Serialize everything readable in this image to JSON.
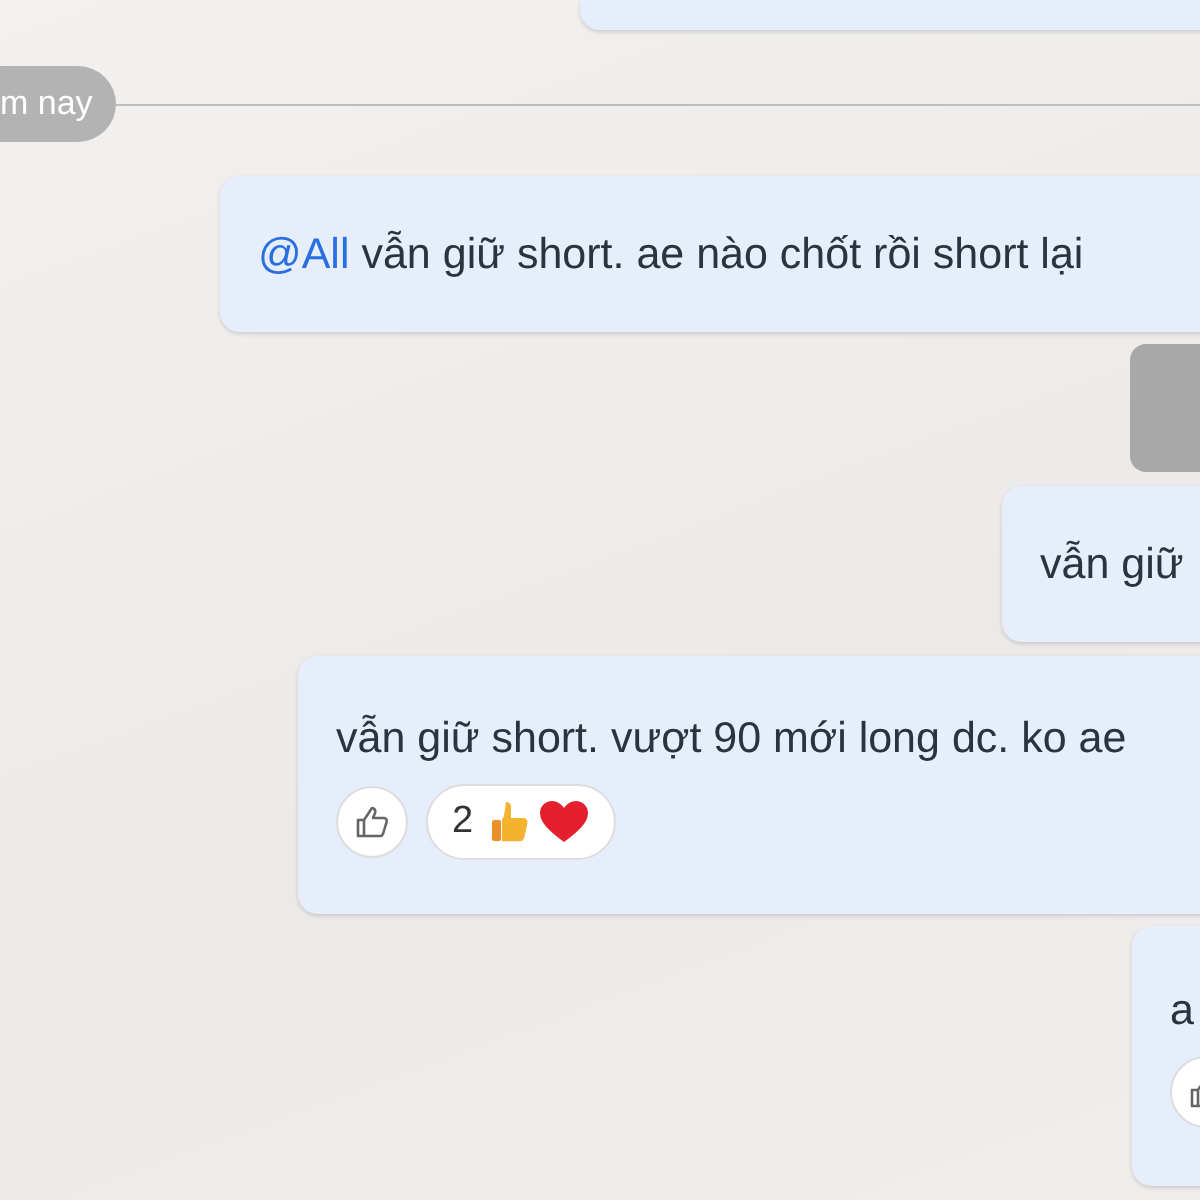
{
  "date_divider": {
    "label": "m nay"
  },
  "messages": [
    {
      "kind": "text"
    },
    {
      "kind": "text",
      "mention": "@All",
      "text": "vẫn giữ short. ae nào chốt rồi short lại"
    },
    {
      "kind": "media"
    },
    {
      "kind": "text",
      "text": "vẫn giữ"
    },
    {
      "kind": "text",
      "text": "vẫn giữ short. vượt 90 mới long dc. ko ae",
      "like_button": true,
      "reactions": {
        "count": "2"
      }
    },
    {
      "kind": "text",
      "text": "a",
      "like_button": true
    }
  ]
}
